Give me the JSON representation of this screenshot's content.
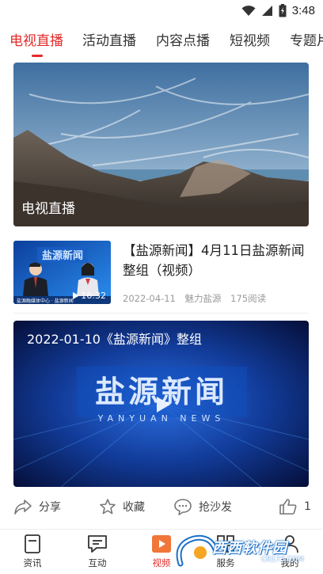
{
  "status_bar": {
    "time": "3:48"
  },
  "tabs": [
    {
      "label": "电视直播",
      "active": true
    },
    {
      "label": "活动直播",
      "active": false
    },
    {
      "label": "内容点播",
      "active": false
    },
    {
      "label": "短视频",
      "active": false
    },
    {
      "label": "专题片",
      "active": false
    }
  ],
  "hero": {
    "label": "电视直播"
  },
  "news": {
    "title": "【盐源新闻】4月11日盐源新闻整组（视频）",
    "duration": "16:32",
    "date": "2022-04-11",
    "source": "魅力盐源",
    "reads": "175阅读",
    "thumb_caption": "盐源融媒体中心",
    "thumb_logo": "盐源新闻"
  },
  "video": {
    "title": "2022-01-10《盐源新闻》整组",
    "logo_text": "盐源新闻",
    "logo_sub": "YANYUAN NEWS"
  },
  "actions": {
    "share": "分享",
    "favorite": "收藏",
    "comment": "抢沙发",
    "likes": "1"
  },
  "bottom_nav": [
    {
      "label": "资讯",
      "active": false
    },
    {
      "label": "互动",
      "active": false
    },
    {
      "label": "视频",
      "active": true
    },
    {
      "label": "服务",
      "active": false
    },
    {
      "label": "我的",
      "active": false
    }
  ],
  "watermark": {
    "text": "西西软件园",
    "sub": "CR173.COM"
  },
  "colors": {
    "accent": "#e32a2a",
    "muted": "#9a9a9a",
    "watermark_blue": "#1b6fc8"
  }
}
